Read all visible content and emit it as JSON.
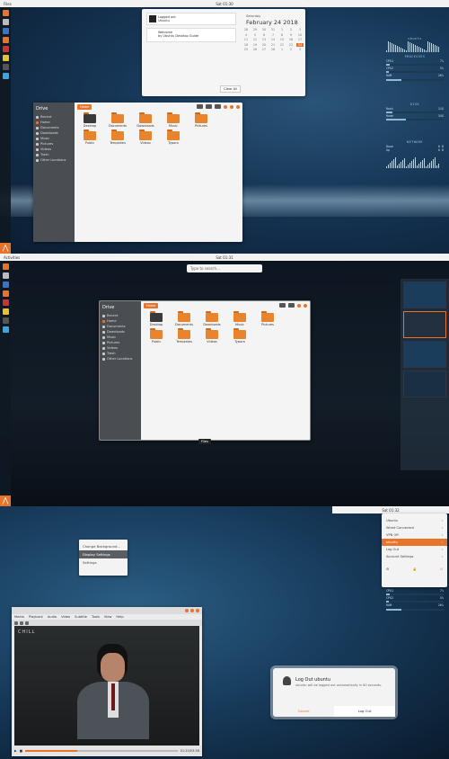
{
  "pane1": {
    "topbar": {
      "app": "Files",
      "clock": "Sat 01:30"
    },
    "notification": {
      "title": "Logged out",
      "line1": "Ubuntu",
      "line2": "Welcome",
      "line3": "by Ubuntu Desktop Guide"
    },
    "calendar": {
      "day": "Saturday",
      "date": "February 24 2018",
      "clear": "Clear All",
      "cells": [
        "28",
        "29",
        "30",
        "31",
        "1",
        "2",
        "3",
        "4",
        "5",
        "6",
        "7",
        "8",
        "9",
        "10",
        "11",
        "12",
        "13",
        "14",
        "15",
        "16",
        "17",
        "18",
        "19",
        "20",
        "21",
        "22",
        "23",
        "24",
        "25",
        "26",
        "27",
        "28",
        "1",
        "2",
        "3"
      ]
    },
    "files": {
      "title": "Drive",
      "crumb": "Home",
      "sidebar": [
        "Recent",
        "Home",
        "Documents",
        "Downloads",
        "Music",
        "Pictures",
        "Videos",
        "Trash",
        "Other Locations"
      ],
      "folders": [
        "Desktop",
        "Documents",
        "Downloads",
        "Music",
        "Pictures",
        "Public",
        "Templates",
        "Videos",
        "Typora"
      ]
    },
    "conky": {
      "host": "ubuntu",
      "sec_proc": "PROCESSES",
      "sec_disk": "DISK",
      "sec_net": "NETWORK",
      "proc": [
        [
          "CPU1",
          "7%"
        ],
        [
          "CPU2",
          "5%"
        ],
        [
          "RAM",
          "26%"
        ]
      ],
      "disk": [
        [
          "Root",
          "11G"
        ],
        [
          "Home",
          "34G"
        ]
      ],
      "net": [
        [
          "Down",
          "0 B"
        ],
        [
          "Up",
          "0 B"
        ]
      ]
    }
  },
  "pane2": {
    "topbar": {
      "app": "Activities",
      "clock": "Sat 01:31"
    },
    "search_placeholder": "Type to search...",
    "files": {
      "title": "Drive",
      "crumb": "Home",
      "sidebar": [
        "Recent",
        "Home",
        "Documents",
        "Downloads",
        "Music",
        "Pictures",
        "Videos",
        "Trash",
        "Other Locations"
      ],
      "folders": [
        "Desktop",
        "Documents",
        "Downloads",
        "Music",
        "Pictures",
        "Public",
        "Templates",
        "Videos",
        "Typora"
      ]
    },
    "window_label": "Files"
  },
  "pane3": {
    "topbar": {
      "clock": "Sat 01:32"
    },
    "context_menu": [
      "Change Background...",
      "Display Settings",
      "Settings"
    ],
    "system_menu": [
      {
        "label": "Ubuntu",
        "hl": false
      },
      {
        "label": "Wired Connected",
        "hl": false
      },
      {
        "label": "VPN Off",
        "hl": false
      },
      {
        "label": "ubuntu",
        "hl": true
      },
      {
        "label": "Log Out",
        "hl": false
      },
      {
        "label": "Account Settings",
        "hl": false
      }
    ],
    "video": {
      "menu": [
        "Media",
        "Playback",
        "Audio",
        "Video",
        "Subtitle",
        "Tools",
        "View",
        "Help"
      ],
      "time": "01:20/03:58",
      "title": "CHILL"
    },
    "logout": {
      "title": "Log Out ubuntu",
      "desc": "ubuntu will be logged out automatically in 60 seconds.",
      "cancel": "Cancel",
      "confirm": "Log Out"
    }
  }
}
